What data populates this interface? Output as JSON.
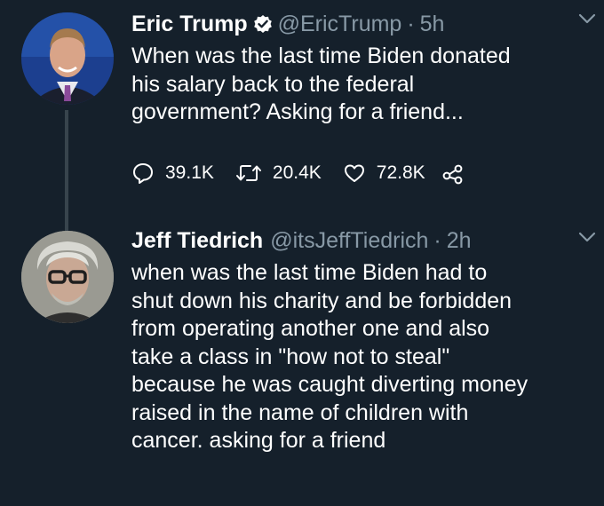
{
  "tweets": [
    {
      "name": "Eric Trump",
      "verified": true,
      "handle": "@EricTrump",
      "separator": "·",
      "time": "5h",
      "text": "When was the last time Biden donated\nhis salary back to the federal\ngovernment? Asking for a friend...",
      "replies": "39.1K",
      "retweets": "20.4K",
      "likes": "72.8K"
    },
    {
      "name": "Jeff Tiedrich",
      "handle": "@itsJeffTiedrich",
      "separator": "·",
      "time": "2h",
      "text": "when was the last time Biden had to\nshut down his charity and be forbidden\nfrom operating another one and also\ntake a class in \"how not to steal\"\nbecause he was caught diverting money\nraised in the name of children with\ncancer. asking for a friend"
    }
  ],
  "colors": {
    "background": "#15202b",
    "secondary_text": "#8899a6",
    "verified_badge": "#ffffff",
    "thread_line": "#38444d"
  },
  "icons": [
    "reply-icon",
    "retweet-icon",
    "like-icon",
    "share-icon",
    "verified-badge-icon",
    "caret-down-icon"
  ]
}
